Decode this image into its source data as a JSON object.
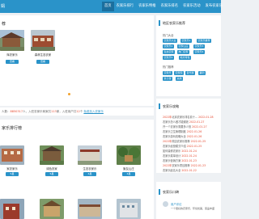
{
  "header": {
    "logo_text": "娟",
    "nav": [
      "首页",
      "农家乐排行",
      "农家乐特推",
      "农家乐排名",
      "农家乐活动",
      "发布农家乐"
    ]
  },
  "main": {
    "section1_title": "荐",
    "card1_name": "辉农家乐",
    "card2_name": "森林生态农家",
    "card_btn": "查看"
  },
  "stats": {
    "prefix": "人数：",
    "visitors": "8850317",
    "mid": "人，入驻农家乐商家共",
    "shops": "113",
    "mid2": "家，入驻用户共",
    "users": "12",
    "suffix": "个",
    "link": "免费加入农家乐"
  },
  "rank": {
    "title": "家乐排行榜",
    "items": [
      {
        "name": "家农家乐",
        "tag": "5星"
      },
      {
        "name": "绿色农家",
        "tag": "5星"
      },
      {
        "name": "生态农家乐",
        "tag": "4星"
      },
      {
        "name": "聚友山庄",
        "tag": "4星"
      }
    ],
    "btn": "查看"
  },
  "sidebar": {
    "recommend_title": "地区农家乐推荐",
    "section_a": "热门大全",
    "tags_a": [
      "农家乐大全",
      "农家乐1",
      "农家乐推荐",
      "农家乐2",
      "农家山庄",
      "农家乐3",
      "生态农家",
      "热门农家",
      "农家乐4",
      "农家乐5",
      "地方特色"
    ],
    "section_b": "热门推荐",
    "tags_b": [
      "农家乐",
      "农家院",
      "自驾游",
      "垂钓",
      "亲子游",
      "采摘"
    ],
    "strategy_title": "农家乐攻略",
    "strategy_lines": [
      {
        "hl": "2022年",
        "text": "北京农家乐排名前十...",
        "date": "2022-01-28"
      },
      {
        "hl": "",
        "text": "农家乐怎么做才能赚钱",
        "date": "2022-01-27"
      },
      {
        "hl": "",
        "text": "开一个农家乐需要多少钱",
        "date": "2022-01-27"
      },
      {
        "hl": "",
        "text": "农家乐卫生管理制度",
        "date": "2022-01-26"
      },
      {
        "hl": "",
        "text": "农家乐游玩攻略大全",
        "date": "2022-01-26"
      },
      {
        "hl": "2022年",
        "text": "周边农家乐推荐",
        "date": "2022-01-25"
      },
      {
        "hl": "",
        "text": "农家乐经营模式介绍",
        "date": "2022-01-25"
      },
      {
        "hl": "",
        "text": "如何装修农家乐",
        "date": "2022-01-24"
      },
      {
        "hl": "",
        "text": "农家乐菜单设计",
        "date": "2022-01-24"
      },
      {
        "hl": "",
        "text": "农家乐营销方案",
        "date": "2022-01-23"
      },
      {
        "hl": "2022年",
        "text": "农家乐项目推荐",
        "date": "2022-01-23"
      },
      {
        "hl": "",
        "text": "农家乐起名大全",
        "date": "2022-01-22"
      }
    ],
    "words_title": "农家乐口碑",
    "comment_user": "用户评论",
    "comment_text": "一个很好的农家乐，环境优美，菜品丰盛"
  },
  "colors": {
    "brand": "#2a93c9",
    "accent": "#e5472d",
    "dot": "#f1a12c"
  }
}
